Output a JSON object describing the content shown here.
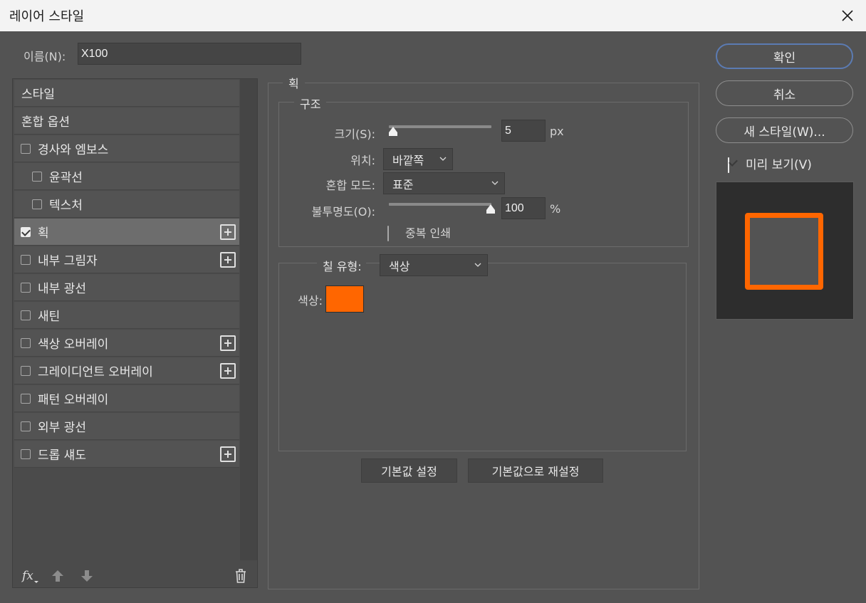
{
  "window": {
    "title": "레이어 스타일"
  },
  "name_field": {
    "label": "이름(N):",
    "value": "X100"
  },
  "styles_list": {
    "items": [
      {
        "label": "스타일",
        "has_checkbox": false,
        "checked": false,
        "has_plus": false,
        "selected": false
      },
      {
        "label": "혼합 옵션",
        "has_checkbox": false,
        "checked": false,
        "has_plus": false,
        "selected": false
      },
      {
        "label": "경사와 엠보스",
        "has_checkbox": true,
        "checked": false,
        "has_plus": false,
        "selected": false
      },
      {
        "label": "윤곽선",
        "has_checkbox": true,
        "checked": false,
        "has_plus": false,
        "selected": false,
        "indented": true
      },
      {
        "label": "텍스처",
        "has_checkbox": true,
        "checked": false,
        "has_plus": false,
        "selected": false,
        "indented": true
      },
      {
        "label": "획",
        "has_checkbox": true,
        "checked": true,
        "has_plus": true,
        "selected": true
      },
      {
        "label": "내부 그림자",
        "has_checkbox": true,
        "checked": false,
        "has_plus": true,
        "selected": false
      },
      {
        "label": "내부 광선",
        "has_checkbox": true,
        "checked": false,
        "has_plus": false,
        "selected": false
      },
      {
        "label": "새틴",
        "has_checkbox": true,
        "checked": false,
        "has_plus": false,
        "selected": false
      },
      {
        "label": "색상 오버레이",
        "has_checkbox": true,
        "checked": false,
        "has_plus": true,
        "selected": false
      },
      {
        "label": "그레이디언트 오버레이",
        "has_checkbox": true,
        "checked": false,
        "has_plus": true,
        "selected": false
      },
      {
        "label": "패턴 오버레이",
        "has_checkbox": true,
        "checked": false,
        "has_plus": false,
        "selected": false
      },
      {
        "label": "외부 광선",
        "has_checkbox": true,
        "checked": false,
        "has_plus": false,
        "selected": false
      },
      {
        "label": "드롭 섀도",
        "has_checkbox": true,
        "checked": false,
        "has_plus": true,
        "selected": false
      }
    ],
    "footer_icons": [
      "fx-icon",
      "arrow-up-icon",
      "arrow-down-icon",
      "trash-icon"
    ]
  },
  "stroke_panel": {
    "group_title": "획",
    "structure": {
      "title": "구조",
      "size": {
        "label": "크기(S):",
        "value": "5",
        "unit": "px",
        "slider_fraction": 0.0
      },
      "position": {
        "label": "위치:",
        "value": "바깥쪽"
      },
      "blend_mode": {
        "label": "혼합 모드:",
        "value": "표준"
      },
      "opacity": {
        "label": "불투명도(O):",
        "value": "100",
        "unit": "%",
        "slider_fraction": 1.0
      },
      "overprint": {
        "label": "중복 인쇄",
        "checked": false
      }
    },
    "fill": {
      "type_label": "칠 유형:",
      "type_value": "색상",
      "color_label": "색상:",
      "color_value": "#ff6600"
    },
    "buttons": {
      "make_default": "기본값 설정",
      "reset_default": "기본값으로 재설정"
    }
  },
  "actions": {
    "ok": "확인",
    "cancel": "취소",
    "new_style": "새 스타일(W)...",
    "preview": {
      "label": "미리 보기(V)",
      "checked": true
    }
  },
  "colors": {
    "accent_stroke": "#ff6600",
    "dialog_bg": "#535353",
    "primary_button_border": "#5b7bb3"
  }
}
